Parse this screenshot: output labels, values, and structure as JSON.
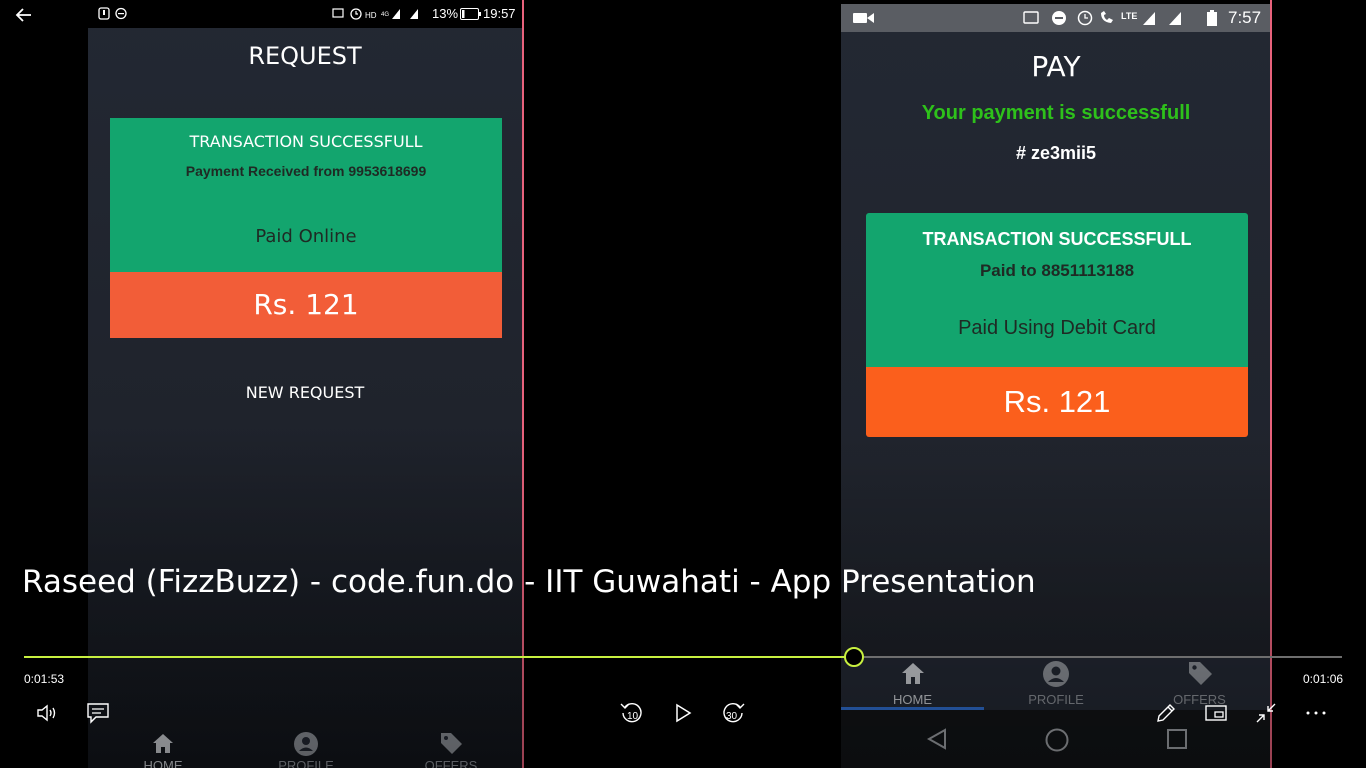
{
  "top_left": {
    "back_icon": "arrow-left-icon"
  },
  "left_phone": {
    "status": {
      "battery_pct": "13%",
      "time": "19:57"
    },
    "title": "REQUEST",
    "card": {
      "headline": "TRANSACTION SUCCESSFULL",
      "subline": "Payment Received from 9953618699",
      "method": "Paid Online",
      "amount": "Rs. 121"
    },
    "new_request_label": "NEW REQUEST",
    "nav": [
      "HOME",
      "PROFILE",
      "OFFERS"
    ]
  },
  "right_phone": {
    "status": {
      "time": "7:57",
      "network": "LTE"
    },
    "title": "PAY",
    "success_message": "Your payment is successfull",
    "reference": "# ze3mii5",
    "card": {
      "headline": "TRANSACTION SUCCESSFULL",
      "subline": "Paid to 8851113188",
      "method": "Paid Using Debit Card",
      "amount": "Rs. 121"
    },
    "nav": [
      "HOME",
      "PROFILE",
      "OFFERS"
    ]
  },
  "player": {
    "title": "Raseed (FizzBuzz) - code.fun.do - IIT Guwahati - App Presentation",
    "elapsed": "0:01:53",
    "remaining": "0:01:06",
    "progress": 0.63,
    "icons": [
      "volume-icon",
      "captions-icon",
      "rewind-10-icon",
      "play-icon",
      "forward-30-icon",
      "pen-icon",
      "mini-view-icon",
      "exit-fullscreen-icon",
      "more-icon"
    ],
    "rewind_label": "10",
    "forward_label": "30"
  },
  "colors": {
    "card_green": "#13a56e",
    "left_amount": "#f25d38",
    "right_amount": "#fb5f1c",
    "success_text": "#2ec11b",
    "progress_line": "#c8f040",
    "phone_bg": "#232833"
  }
}
